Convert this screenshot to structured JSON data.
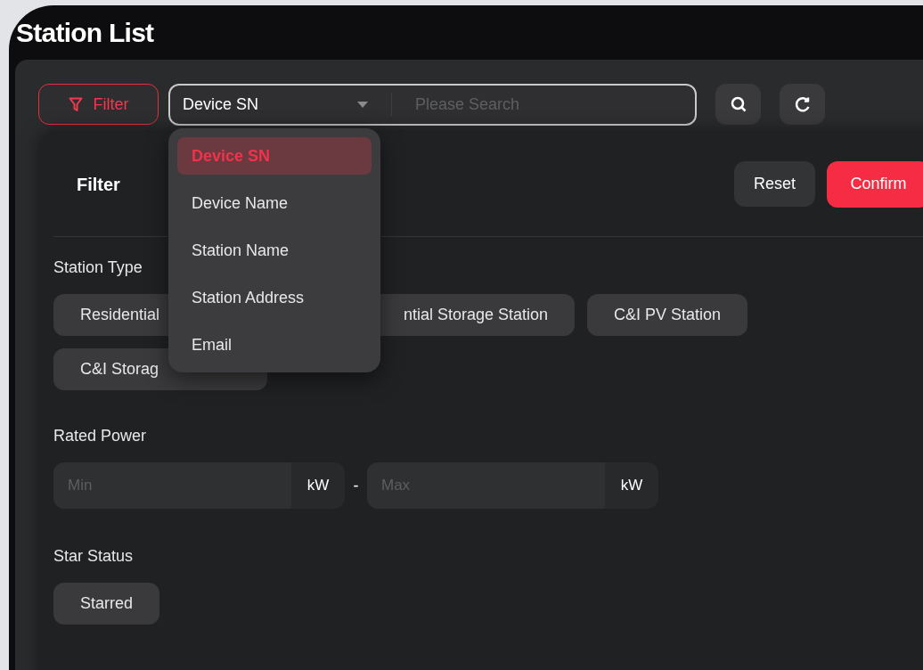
{
  "page": {
    "title": "Station List"
  },
  "toolbar": {
    "filter_button": {
      "label": "Filter",
      "active": true
    },
    "search_type": {
      "value": "Device SN",
      "expanded": true,
      "options": [
        {
          "label": "Device SN",
          "selected": true
        },
        {
          "label": "Device Name",
          "selected": false
        },
        {
          "label": "Station Name",
          "selected": false
        },
        {
          "label": "Station Address",
          "selected": false
        },
        {
          "label": "Email",
          "selected": false
        }
      ]
    },
    "search": {
      "placeholder": "Please Search"
    }
  },
  "filter_panel": {
    "title": "Filter",
    "reset": "Reset",
    "confirm": "Confirm",
    "sections": [
      {
        "kind": "chips",
        "label": "Station Type",
        "chips": [
          "Residential",
          "ntial Storage Station",
          "C&I PV Station",
          "C&I Storag"
        ]
      },
      {
        "kind": "range",
        "label": "Rated Power",
        "min": {
          "placeholder": "Min",
          "unit": "kW"
        },
        "separator": "-",
        "max": {
          "placeholder": "Max",
          "unit": "kW"
        }
      },
      {
        "kind": "chips",
        "label": "Star Status",
        "chips": [
          "Starred"
        ]
      }
    ]
  }
}
